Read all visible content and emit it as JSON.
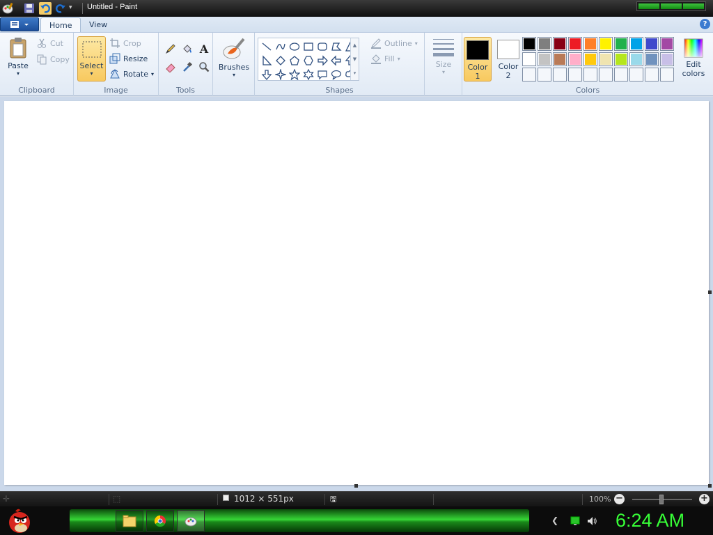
{
  "window": {
    "title": "Untitled - Paint"
  },
  "tabs": {
    "app_menu": "☰",
    "home": "Home",
    "view": "View",
    "help": "?"
  },
  "clipboard": {
    "paste": "Paste",
    "cut": "Cut",
    "copy": "Copy",
    "group": "Clipboard"
  },
  "image": {
    "select": "Select",
    "crop": "Crop",
    "resize": "Resize",
    "rotate": "Rotate",
    "group": "Image"
  },
  "tools": {
    "group": "Tools",
    "text_glyph": "A"
  },
  "brushes": {
    "label": "Brushes"
  },
  "shapes": {
    "outline": "Outline",
    "fill": "Fill",
    "group": "Shapes"
  },
  "size": {
    "label": "Size"
  },
  "colors": {
    "color1_line1": "Color",
    "color1_line2": "1",
    "color2_line1": "Color",
    "color2_line2": "2",
    "edit_line1": "Edit",
    "edit_line2": "colors",
    "group": "Colors",
    "color1_value": "#000000",
    "color2_value": "#ffffff",
    "palette": [
      "#000000",
      "#7f7f7f",
      "#880015",
      "#ed1c24",
      "#ff7f27",
      "#fff200",
      "#22b14c",
      "#00a2e8",
      "#3f48cc",
      "#a349a4",
      "#ffffff",
      "#c3c3c3",
      "#b97a57",
      "#ffaec9",
      "#ffc90e",
      "#efe4b0",
      "#b5e61d",
      "#99d9ea",
      "#7092be",
      "#c8bfe7"
    ]
  },
  "status": {
    "canvas_size": "1012 × 551px",
    "zoom": "100%"
  },
  "taskbar": {
    "clock": "6:24 AM"
  }
}
